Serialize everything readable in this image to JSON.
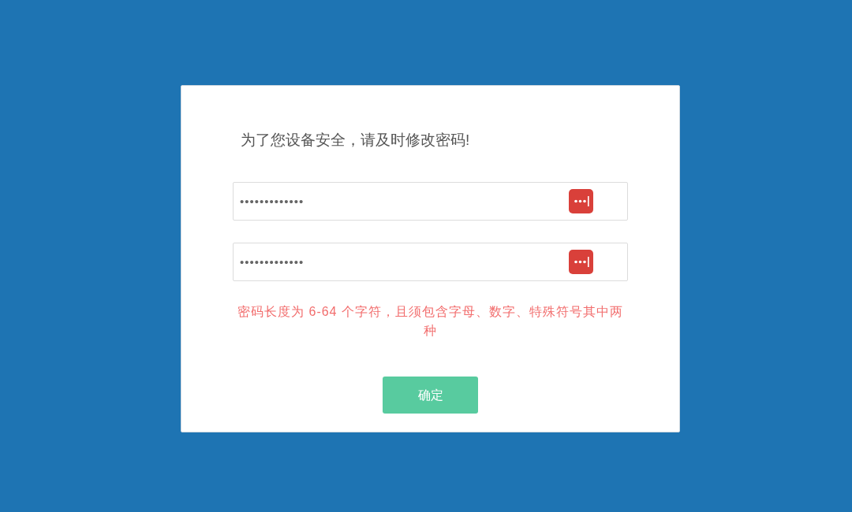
{
  "dialog": {
    "title": "为了您设备安全，请及时修改密码!",
    "fields": [
      {
        "value": "•••••••••••••"
      },
      {
        "value": "•••••••••••••"
      }
    ],
    "hint": "密码长度为 6-64 个字符，且须包含字母、数字、特殊符号其中两种",
    "button": "确定"
  }
}
